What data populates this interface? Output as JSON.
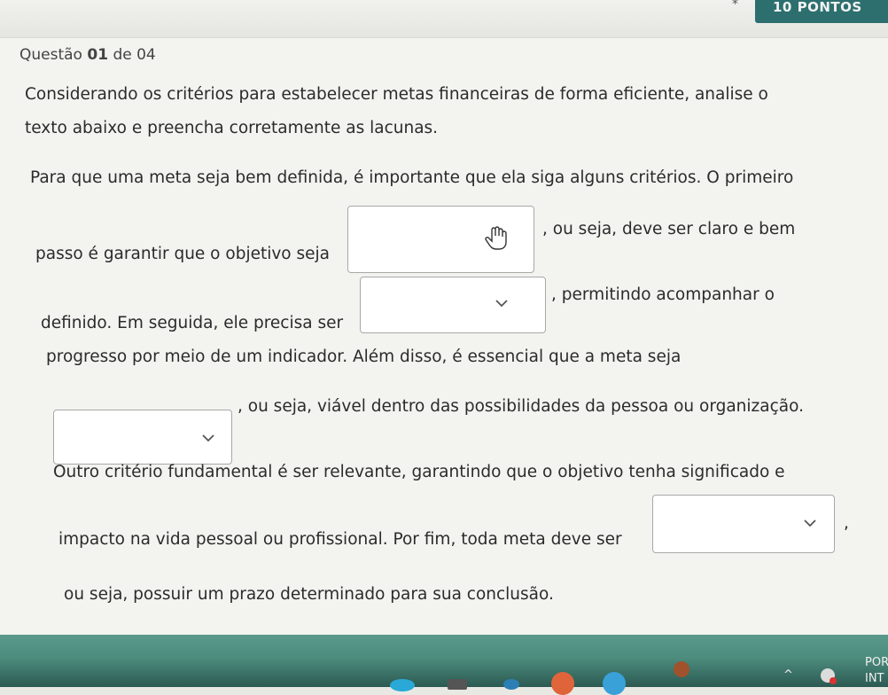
{
  "header": {
    "points_label": "10 PONTOS",
    "star": "*"
  },
  "question": {
    "label_prefix": "Questão",
    "number": "01",
    "label_suffix": "de 04",
    "instruction_line1": "Considerando os critérios para estabelecer metas financeiras de forma eficiente, analise o",
    "instruction_line2": "texto abaixo e preencha corretamente as lacunas.",
    "para_line1": "Para que uma meta seja bem definida, é importante que ela siga alguns critérios. O primeiro",
    "para_line2_before": "passo é garantir que o objetivo seja",
    "para_line2_after": ", ou seja, deve ser claro e bem",
    "para_line3_before": "definido. Em seguida, ele precisa ser",
    "para_line3_after": ", permitindo acompanhar o",
    "para_line4": "progresso por meio de um indicador. Além disso, é essencial que a meta seja",
    "para_line5_after": ", ou seja, viável dentro das possibilidades da pessoa ou organização.",
    "para_line6": "Outro critério fundamental é ser relevante, garantindo que o objetivo tenha significado e",
    "para_line7_before": "impacto na vida pessoal ou profissional. Por fim, toda meta deve ser",
    "para_line7_after": ",",
    "para_line8": "ou seja, possuir um prazo determinado para sua conclusão.",
    "dropdowns": [
      {
        "selected": ""
      },
      {
        "selected": ""
      },
      {
        "selected": ""
      },
      {
        "selected": ""
      }
    ]
  },
  "taskbar": {
    "lang_top": "POR",
    "lang_bottom": "INT",
    "tray_up": "^"
  },
  "colors": {
    "accent": "#2d6f6f",
    "taskbar": "#4c8d7f"
  }
}
